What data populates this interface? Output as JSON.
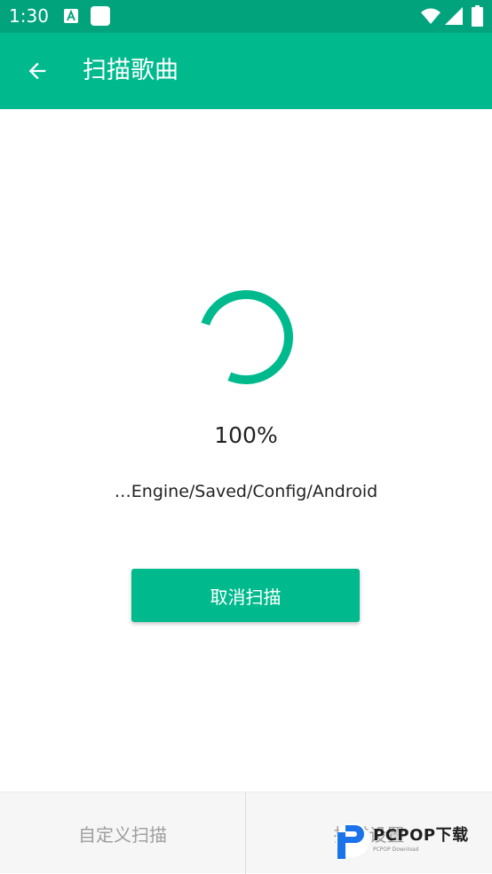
{
  "status_bar": {
    "time": "1:30",
    "icons": [
      "a-notification-icon",
      "square-notification-icon",
      "wifi-icon",
      "signal-icon",
      "battery-icon"
    ]
  },
  "app_bar": {
    "title": "扫描歌曲",
    "back_icon": "arrow-back-icon"
  },
  "scan": {
    "progress_text": "100%",
    "progress_value": 100,
    "current_path": "…Engine/Saved/Config/Android",
    "cancel_label": "取消扫描"
  },
  "bottom_tabs": {
    "custom_scan": "自定义扫描",
    "scan_settings": "扫描设置"
  },
  "watermark": {
    "brand": "PCPOP下载",
    "sub": "PCPOP Download"
  },
  "colors": {
    "status_bar": "#00a37c",
    "accent": "#00ba8e",
    "text": "#222222",
    "muted_text": "#9e9e9e",
    "bottom_bg": "#f6f6f6"
  }
}
